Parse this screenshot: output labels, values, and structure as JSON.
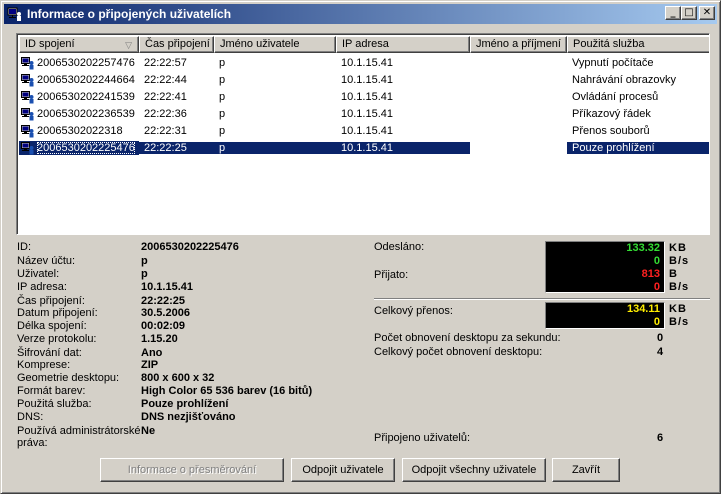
{
  "window": {
    "title": "Informace o připojených uživatelích",
    "minimize_glyph": "_",
    "maximize_glyph": "□",
    "close_glyph": "✕",
    "icon": "users-network-icon"
  },
  "table": {
    "sort_arrow": "▽",
    "columns": [
      "ID spojení",
      "Čas připojení",
      "Jméno uživatele",
      "IP adresa",
      "Jméno a příjmení",
      "Použitá služba"
    ],
    "rows": [
      {
        "id": "2006530202257476",
        "time": "22:22:57",
        "user": "p",
        "ip": "10.1.15.41",
        "fullname": "",
        "service": "Vypnutí počítače"
      },
      {
        "id": "2006530202244664",
        "time": "22:22:44",
        "user": "p",
        "ip": "10.1.15.41",
        "fullname": "",
        "service": "Nahrávání obrazovky"
      },
      {
        "id": "2006530202241539",
        "time": "22:22:41",
        "user": "p",
        "ip": "10.1.15.41",
        "fullname": "",
        "service": "Ovládání procesů"
      },
      {
        "id": "2006530202236539",
        "time": "22:22:36",
        "user": "p",
        "ip": "10.1.15.41",
        "fullname": "",
        "service": "Příkazový řádek"
      },
      {
        "id": "20065302022318",
        "time": "22:22:31",
        "user": "p",
        "ip": "10.1.15.41",
        "fullname": "",
        "service": "Přenos souborů"
      },
      {
        "id": "2006530202225476",
        "time": "22:22:25",
        "user": "p",
        "ip": "10.1.15.41",
        "fullname": "",
        "service": "Pouze prohlížení"
      }
    ],
    "selected_index": 5
  },
  "details": [
    {
      "label": "ID:",
      "value": "2006530202225476"
    },
    {
      "label": "Název účtu:",
      "value": "p"
    },
    {
      "label": "Uživatel:",
      "value": "p"
    },
    {
      "label": "IP adresa:",
      "value": "10.1.15.41"
    },
    {
      "label": "Čas připojení:",
      "value": "22:22:25"
    },
    {
      "label": "Datum připojení:",
      "value": "30.5.2006"
    },
    {
      "label": "Délka spojení:",
      "value": "00:02:09"
    },
    {
      "label": "Verze protokolu:",
      "value": "1.15.20"
    },
    {
      "label": "Šifrování dat:",
      "value": "Ano"
    },
    {
      "label": "Komprese:",
      "value": "ZIP"
    },
    {
      "label": "Geometrie desktopu:",
      "value": "800 x 600 x 32"
    },
    {
      "label": "Formát barev:",
      "value": "High Color 65 536 barev (16 bitů)"
    },
    {
      "label": "Použitá služba:",
      "value": "Pouze prohlížení"
    },
    {
      "label": "DNS:",
      "value": "DNS nezjišťováno"
    },
    {
      "label": "Používá administrátorské práva:",
      "value": "Ne"
    }
  ],
  "stats": {
    "sent_label": "Odesláno:",
    "sent_total": "133.32",
    "sent_total_unit": "KB",
    "sent_rate": "0",
    "sent_rate_unit": "B/s",
    "received_label": "Přijato:",
    "received_total": "813",
    "received_total_unit": "B",
    "received_rate": "0",
    "received_rate_unit": "B/s",
    "transfer_label": "Celkový přenos:",
    "transfer_total": "134.11",
    "transfer_total_unit": "KB",
    "transfer_rate": "0",
    "transfer_rate_unit": "B/s",
    "refresh_per_sec_label": "Počet obnovení desktopu za sekundu:",
    "refresh_per_sec": "0",
    "refresh_total_label": "Celkový počet obnovení desktopu:",
    "refresh_total": "4",
    "connected_label": "Připojeno uživatelů:",
    "connected_count": "6"
  },
  "colors": {
    "sent": "#33dd33",
    "rate": "#ffee00",
    "received": "#ff2020",
    "transfer": "#ffee00",
    "selection": "#0a246a"
  },
  "buttons": {
    "redirect_info": "Informace o přesměrování",
    "disconnect_user": "Odpojit uživatele",
    "disconnect_all": "Odpojit všechny uživatele",
    "close": "Zavřít"
  }
}
